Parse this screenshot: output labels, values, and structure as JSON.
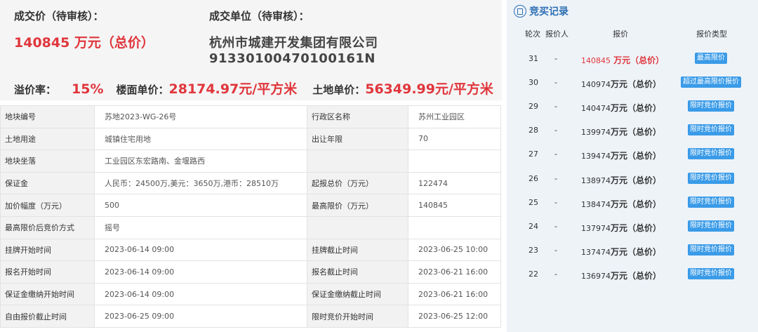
{
  "summary": {
    "price_label": "成交价（待审核）：",
    "price_value": "140845 万元（总价）",
    "unit_label": "成交单位（待审核）：",
    "unit_name": "杭州市城建开发集团有限公司",
    "unit_code": "91330100470100161N",
    "premium_label": "溢价率：",
    "premium_value": "15%",
    "floor_price_label": "楼面单价：",
    "floor_price_value": "28174.97元/平方米",
    "land_price_label": "土地单价：",
    "land_price_value": "56349.99元/平方米"
  },
  "details": {
    "rows": [
      {
        "k1": "地块编号",
        "v1": "苏地2023-WG-26号",
        "k2": "行政区名称",
        "v2": "苏州工业园区"
      },
      {
        "k1": "土地用途",
        "v1": "城镇住宅用地",
        "k2": "出让年限",
        "v2": "70"
      },
      {
        "k1": "地块坐落",
        "v1": "工业园区东宏路南、金堰路西",
        "k2": "",
        "v2": ""
      },
      {
        "k1": "保证金",
        "v1": "人民币：24500万,美元：3650万,港币：28510万",
        "k2": "起报总价（万元）",
        "v2": "122474"
      },
      {
        "k1": "加价幅度（万元）",
        "v1": "500",
        "k2": "最高限价（万元）",
        "v2": "140845"
      },
      {
        "k1": "最高限价后竞价方式",
        "v1": "摇号",
        "k2": "",
        "v2": ""
      },
      {
        "k1": "挂牌开始时间",
        "v1": "2023-06-14 09:00",
        "k2": "挂牌截止时间",
        "v2": "2023-06-25 10:00"
      },
      {
        "k1": "报名开始时间",
        "v1": "2023-06-14 09:00",
        "k2": "报名截止时间",
        "v2": "2023-06-21 16:00"
      },
      {
        "k1": "保证金缴纳开始时间",
        "v1": "2023-06-14 09:00",
        "k2": "保证金缴纳截止时间",
        "v2": "2023-06-21 16:00"
      },
      {
        "k1": "自由报价截止时间",
        "v1": "2023-06-25 09:00",
        "k2": "限时竞价开始时间",
        "v2": "2023-06-25 12:00"
      }
    ]
  },
  "bid_record": {
    "title": "竞买记录",
    "headers": {
      "round": "轮次",
      "bidder": "报价人",
      "bid": "报价",
      "type": "报价类型"
    },
    "rows": [
      {
        "round": "31",
        "bidder": "-",
        "amount": "140845",
        "unit": " 万元（总价）",
        "type": "最高限价",
        "highlight": true
      },
      {
        "round": "30",
        "bidder": "-",
        "amount": "140974",
        "unit": "万元（总价）",
        "type": "超过最高限价报价",
        "highlight": false
      },
      {
        "round": "29",
        "bidder": "-",
        "amount": "140474",
        "unit": "万元（总价）",
        "type": "限时竞价报价",
        "highlight": false
      },
      {
        "round": "28",
        "bidder": "-",
        "amount": "139974",
        "unit": "万元（总价）",
        "type": "限时竞价报价",
        "highlight": false
      },
      {
        "round": "27",
        "bidder": "-",
        "amount": "139474",
        "unit": "万元（总价）",
        "type": "限时竞价报价",
        "highlight": false
      },
      {
        "round": "26",
        "bidder": "-",
        "amount": "138974",
        "unit": "万元（总价）",
        "type": "限时竞价报价",
        "highlight": false
      },
      {
        "round": "25",
        "bidder": "-",
        "amount": "138474",
        "unit": "万元（总价）",
        "type": "限时竞价报价",
        "highlight": false
      },
      {
        "round": "24",
        "bidder": "-",
        "amount": "137974",
        "unit": "万元（总价）",
        "type": "限时竞价报价",
        "highlight": false
      },
      {
        "round": "23",
        "bidder": "-",
        "amount": "137474",
        "unit": "万元（总价）",
        "type": "限时竞价报价",
        "highlight": false
      },
      {
        "round": "22",
        "bidder": "-",
        "amount": "136974",
        "unit": "万元（总价）",
        "type": "限时竞价报价",
        "highlight": false
      }
    ]
  },
  "colors": {
    "accent_red": "#e0363c",
    "badge_blue": "#3a9be8",
    "title_blue": "#2c6fb3",
    "panel_bg": "#eef3f8"
  },
  "icons": {
    "record_icon": "document-circle-icon"
  }
}
